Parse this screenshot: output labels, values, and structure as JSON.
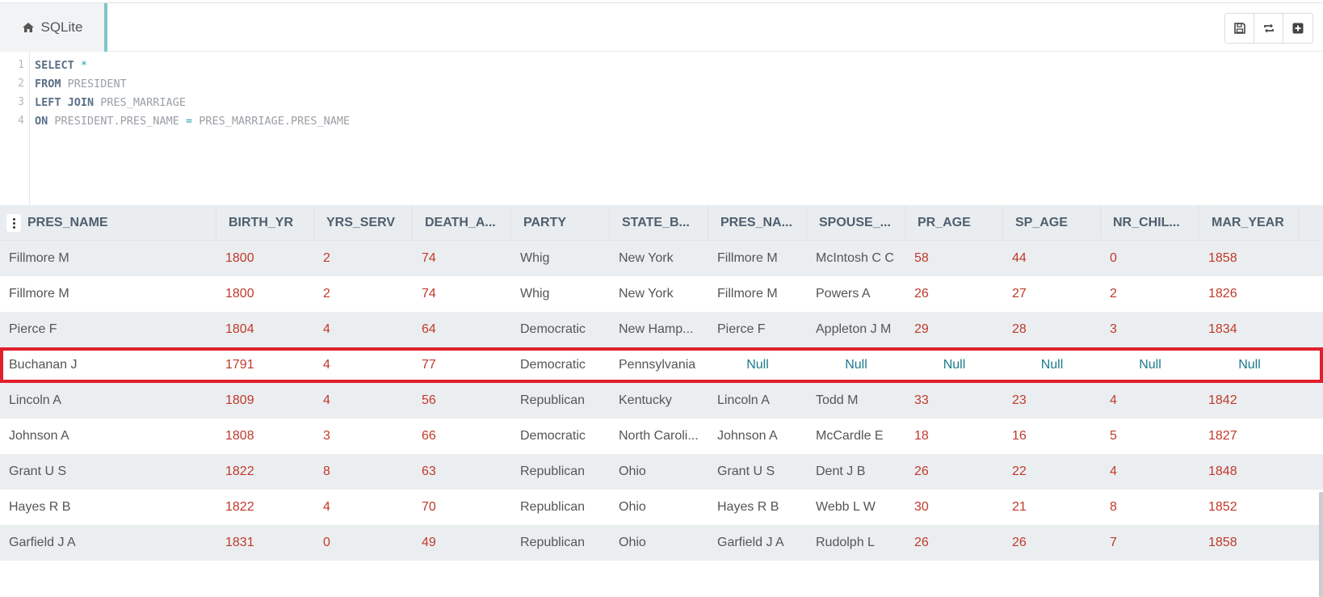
{
  "tab": {
    "label": "SQLite"
  },
  "editor": {
    "line_numbers": [
      "1",
      "2",
      "3",
      "4"
    ],
    "lines": [
      [
        {
          "t": "kw",
          "v": "SELECT"
        },
        {
          "t": "tx",
          "v": " "
        },
        {
          "t": "op",
          "v": "*"
        }
      ],
      [
        {
          "t": "kw",
          "v": "FROM"
        },
        {
          "t": "tx",
          "v": " PRESIDENT"
        }
      ],
      [
        {
          "t": "kw",
          "v": "LEFT JOIN"
        },
        {
          "t": "tx",
          "v": " PRES_MARRIAGE"
        }
      ],
      [
        {
          "t": "kw",
          "v": "ON"
        },
        {
          "t": "tx",
          "v": " PRESIDENT.PRES_NAME "
        },
        {
          "t": "op",
          "v": "="
        },
        {
          "t": "tx",
          "v": " PRES_MARRIAGE.PRES_NAME"
        }
      ]
    ]
  },
  "grid": {
    "columns": [
      "PRES_NAME",
      "BIRTH_YR",
      "YRS_SERV",
      "DEATH_A...",
      "PARTY",
      "STATE_B...",
      "PRES_NA...",
      "SPOUSE_...",
      "PR_AGE",
      "SP_AGE",
      "NR_CHIL...",
      "MAR_YEAR"
    ],
    "rows": [
      [
        "Fillmore M",
        "1800",
        "2",
        "74",
        "Whig",
        "New York",
        "Fillmore M",
        "McIntosh C C",
        "58",
        "44",
        "0",
        "1858"
      ],
      [
        "Fillmore M",
        "1800",
        "2",
        "74",
        "Whig",
        "New York",
        "Fillmore M",
        "Powers A",
        "26",
        "27",
        "2",
        "1826"
      ],
      [
        "Pierce F",
        "1804",
        "4",
        "64",
        "Democratic",
        "New Hamp...",
        "Pierce F",
        "Appleton J M",
        "29",
        "28",
        "3",
        "1834"
      ],
      [
        "Buchanan J",
        "1791",
        "4",
        "77",
        "Democratic",
        "Pennsylvania",
        "Null",
        "Null",
        "Null",
        "Null",
        "Null",
        "Null"
      ],
      [
        "Lincoln A",
        "1809",
        "4",
        "56",
        "Republican",
        "Kentucky",
        "Lincoln A",
        "Todd M",
        "33",
        "23",
        "4",
        "1842"
      ],
      [
        "Johnson A",
        "1808",
        "3",
        "66",
        "Democratic",
        "North Caroli...",
        "Johnson A",
        "McCardle E",
        "18",
        "16",
        "5",
        "1827"
      ],
      [
        "Grant U S",
        "1822",
        "8",
        "63",
        "Republican",
        "Ohio",
        "Grant U S",
        "Dent J B",
        "26",
        "22",
        "4",
        "1848"
      ],
      [
        "Hayes R B",
        "1822",
        "4",
        "70",
        "Republican",
        "Ohio",
        "Hayes R B",
        "Webb L W",
        "30",
        "21",
        "8",
        "1852"
      ],
      [
        "Garfield J A",
        "1831",
        "0",
        "49",
        "Republican",
        "Ohio",
        "Garfield J A",
        "Rudolph L",
        "26",
        "26",
        "7",
        "1858"
      ]
    ],
    "selected_row": 3
  },
  "colors": {
    "accent": "#7fc6c6",
    "selection": "#e0202d",
    "number": "#c0392b",
    "null": "#1a7a8c"
  },
  "icons": {
    "tab": "home-icon",
    "toolbar": [
      "save-icon",
      "refresh-icon",
      "add-icon"
    ]
  }
}
